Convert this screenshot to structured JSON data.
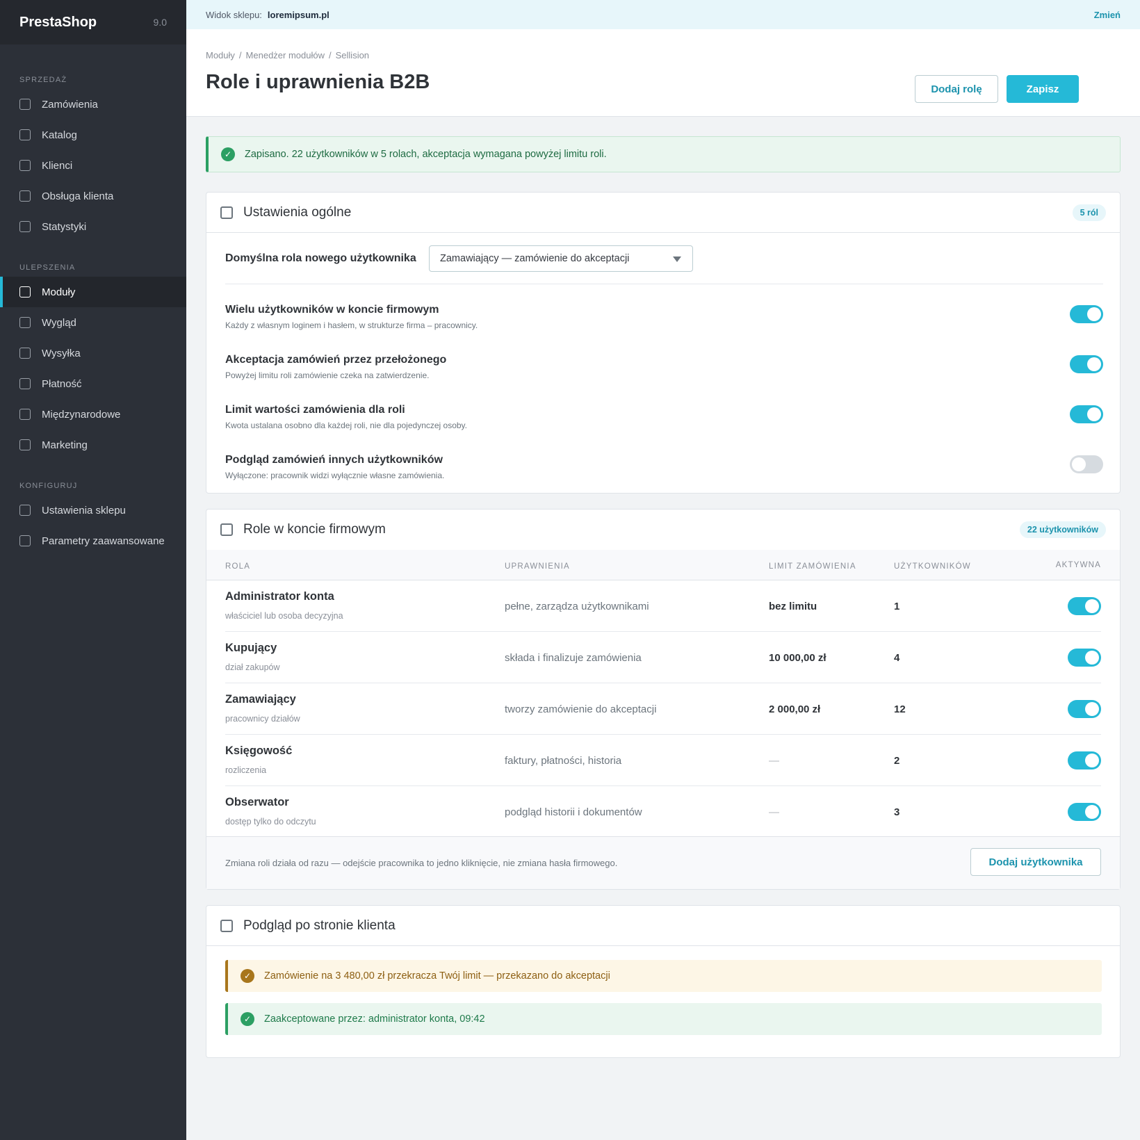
{
  "sidebar": {
    "brand": "PrestaShop",
    "version": "9.0",
    "sections": [
      {
        "label": "SPRZEDAŻ",
        "items": [
          "Zamówienia",
          "Katalog",
          "Klienci",
          "Obsługa klienta",
          "Statystyki"
        ]
      },
      {
        "label": "ULEPSZENIA",
        "items": [
          "Moduły",
          "Wygląd",
          "Wysyłka",
          "Płatność",
          "Międzynarodowe",
          "Marketing"
        ]
      },
      {
        "label": "KONFIGURUJ",
        "items": [
          "Ustawienia sklepu",
          "Parametry zaawansowane"
        ]
      }
    ],
    "active_item": "Moduły"
  },
  "topbar": {
    "label": "Widok sklepu:",
    "shop": "loremipsum.pl",
    "change": "Zmień"
  },
  "header": {
    "breadcrumb": [
      "Moduły",
      "Menedżer modułów",
      "Sellision"
    ],
    "title": "Role i uprawnienia B2B",
    "add_role": "Dodaj rolę",
    "save": "Zapisz"
  },
  "alert": {
    "text": "Zapisano. 22 użytkowników w 5 rolach, akceptacja wymagana powyżej limitu roli."
  },
  "general": {
    "title": "Ustawienia ogólne",
    "badge": "5 ról",
    "default_role_label": "Domyślna rola nowego użytkownika",
    "default_role_value": "Zamawiający — zamówienie do akceptacji",
    "settings": [
      {
        "title": "Wielu użytkowników w koncie firmowym",
        "desc": "Każdy z własnym loginem i hasłem, w strukturze firma – pracownicy.",
        "on": true
      },
      {
        "title": "Akceptacja zamówień przez przełożonego",
        "desc": "Powyżej limitu roli zamówienie czeka na zatwierdzenie.",
        "on": true
      },
      {
        "title": "Limit wartości zamówienia dla roli",
        "desc": "Kwota ustalana osobno dla każdej roli, nie dla pojedynczej osoby.",
        "on": true
      },
      {
        "title": "Podgląd zamówień innych użytkowników",
        "desc": "Wyłączone: pracownik widzi wyłącznie własne zamówienia.",
        "on": false
      }
    ]
  },
  "roles": {
    "title": "Role w koncie firmowym",
    "badge": "22 użytkowników",
    "columns": {
      "role": "ROLA",
      "perms": "UPRAWNIENIA",
      "limit": "LIMIT ZAMÓWIENIA",
      "users": "UŻYTKOWNIKÓW",
      "active": "AKTYWNA"
    },
    "rows": [
      {
        "name": "Administrator konta",
        "sub": "właściciel lub osoba decyzyjna",
        "perms": "pełne, zarządza użytkownikami",
        "limit": "bez limitu",
        "users": "1",
        "active": true
      },
      {
        "name": "Kupujący",
        "sub": "dział zakupów",
        "perms": "składa i finalizuje zamówienia",
        "limit": "10 000,00 zł",
        "users": "4",
        "active": true
      },
      {
        "name": "Zamawiający",
        "sub": "pracownicy działów",
        "perms": "tworzy zamówienie do akceptacji",
        "limit": "2 000,00 zł",
        "users": "12",
        "active": true
      },
      {
        "name": "Księgowość",
        "sub": "rozliczenia",
        "perms": "faktury, płatności, historia",
        "limit": "—",
        "users": "2",
        "active": true
      },
      {
        "name": "Obserwator",
        "sub": "dostęp tylko do odczytu",
        "perms": "podgląd historii i dokumentów",
        "limit": "—",
        "users": "3",
        "active": true
      }
    ],
    "footer_note": "Zmiana roli działa od razu — odejście pracownika to jedno kliknięcie, nie zmiana hasła firmowego.",
    "add_user": "Dodaj użytkownika"
  },
  "preview": {
    "title": "Podgląd po stronie klienta",
    "warning": "Zamówienie na 3 480,00 zł przekracza Twój limit — przekazano do akceptacji",
    "accepted": "Zaakceptowane przez: administrator konta, 09:42"
  }
}
